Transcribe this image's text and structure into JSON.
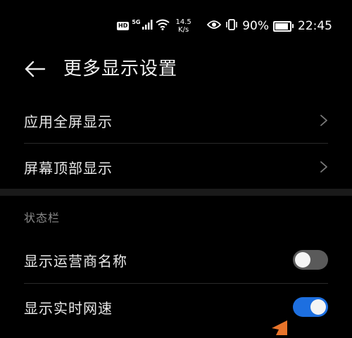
{
  "status_bar": {
    "hd_label": "HD",
    "network_type": "5G",
    "speed_value": "14.5",
    "speed_unit": "K/s",
    "battery_text": "90%",
    "battery_level": 0.9,
    "time": "22:45",
    "icons": [
      "signal-bars-icon",
      "wifi-icon",
      "eye-icon",
      "vibrate-icon",
      "battery-icon"
    ]
  },
  "header": {
    "back_icon": "back-arrow-icon",
    "title": "更多显示设置"
  },
  "items": [
    {
      "label": "应用全屏显示",
      "icon": "chevron-right-icon"
    },
    {
      "label": "屏幕顶部显示",
      "icon": "chevron-right-icon"
    }
  ],
  "section": {
    "title": "状态栏"
  },
  "toggles": [
    {
      "label": "显示运营商名称",
      "state": "off"
    },
    {
      "label": "显示实时网速",
      "state": "on"
    }
  ],
  "colors": {
    "background": "#000000",
    "toggle_on": "#1d6fe0",
    "toggle_off": "#5a5a5a",
    "annotation_arrow": "#e8742a"
  }
}
